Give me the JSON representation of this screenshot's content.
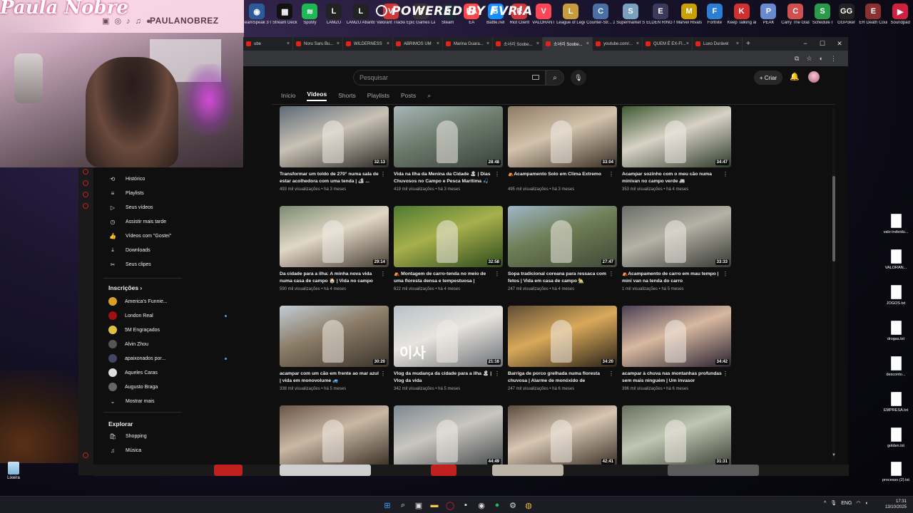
{
  "top_apps": [
    {
      "label": "TeamSpeak 3 Client",
      "color": "#2b5b9b",
      "glyph": "◉"
    },
    {
      "label": "Stream Deck",
      "color": "#111111",
      "glyph": "▦"
    },
    {
      "label": "Spotify",
      "color": "#1db954",
      "glyph": "≋"
    },
    {
      "label": "LAMZU",
      "color": "#222222",
      "glyph": "L"
    },
    {
      "label": "LAMZU Atlantis P...",
      "color": "#222222",
      "glyph": "L"
    },
    {
      "label": "Valorant Tracker",
      "color": "#d13639",
      "glyph": "V"
    },
    {
      "label": "Epic Games Launcher",
      "color": "#333333",
      "glyph": "E"
    },
    {
      "label": "Steam",
      "color": "#1b2838",
      "glyph": "S"
    },
    {
      "label": "EA",
      "color": "#ff4747",
      "glyph": "EA"
    },
    {
      "label": "Battle.net",
      "color": "#148eff",
      "glyph": "B"
    },
    {
      "label": "Riot Client",
      "color": "#d13639",
      "glyph": "R"
    },
    {
      "label": "VALORANT",
      "color": "#ff4655",
      "glyph": "V"
    },
    {
      "label": "League of Legends",
      "color": "#c89b3c",
      "glyph": "L"
    },
    {
      "label": "Counter-Str... 2",
      "color": "#4a6fa5",
      "glyph": "C"
    },
    {
      "label": "Supermarket Simulator",
      "color": "#7aa0c0",
      "glyph": "S"
    },
    {
      "label": "ELDEN RING NIGHTREIGN",
      "color": "#3a3a5a",
      "glyph": "E"
    },
    {
      "label": "Marvel Rivals",
      "color": "#c8a000",
      "glyph": "M"
    },
    {
      "label": "Fortnite",
      "color": "#2a7fd4",
      "glyph": "F"
    },
    {
      "label": "Keep Talking and Nobo...",
      "color": "#d03030",
      "glyph": "K"
    },
    {
      "label": "PEAK",
      "color": "#6a8ad0",
      "glyph": "P"
    },
    {
      "label": "Carry The Glass",
      "color": "#d05050",
      "glyph": "C"
    },
    {
      "label": "Schedule I",
      "color": "#2a9a4a",
      "glyph": "S"
    },
    {
      "label": "GGPoker",
      "color": "#222222",
      "glyph": "GG"
    },
    {
      "label": "ER Death Counter",
      "color": "#8a3030",
      "glyph": "E"
    },
    {
      "label": "Soundpad",
      "color": "#d02040",
      "glyph": "▶"
    }
  ],
  "powered_by": "POWERED BY FVRIA",
  "webcam": {
    "signature": "Paula Nobre",
    "handle": "PAULANOBREZ",
    "socials": "▣ ◎ ♪ ♫ ●"
  },
  "browser": {
    "tabs": [
      {
        "label": "ube",
        "active": false
      },
      {
        "label": "Noru Saru Bu...",
        "active": false
      },
      {
        "label": "WILDERNESS",
        "active": false
      },
      {
        "label": "ABRIMOS UM",
        "active": false
      },
      {
        "label": "Marina Guara...",
        "active": false
      },
      {
        "label": "소녀리 Soobe...",
        "active": false
      },
      {
        "label": "소녀리 Soobe...",
        "active": true
      },
      {
        "label": "youtube.com/...",
        "active": false
      },
      {
        "label": "QUEM É EX-FI...",
        "active": false
      },
      {
        "label": "Luxo Durável",
        "active": false
      }
    ]
  },
  "yt": {
    "search_placeholder": "Pesquisar",
    "create_label": "+ Criar",
    "nav": [
      "Início",
      "Vídeos",
      "Shorts",
      "Playlists",
      "Posts"
    ],
    "active_nav": 1
  },
  "videos": [
    {
      "title": "Transformar um toldo de 270° numa sala de estar acolhedora com uma tenda | 🏕 ...",
      "meta": "493 mil visualizações • há 3 meses",
      "duration": "32:13",
      "colors": [
        "#5d6a77",
        "#c9c2b5",
        "#2e2a26"
      ]
    },
    {
      "title": "Vida na Ilha da Menina da Cidade 🏝 | Dias Chuvosos no Campo e Pesca Marítima 🎣",
      "meta": "419 mil visualizações • há 3 meses",
      "duration": "28:48",
      "colors": [
        "#a7b6b7",
        "#6d7c6d",
        "#38403a"
      ]
    },
    {
      "title": "⛺Acampamento Solo em Clima Extremo",
      "meta": "495 mil visualizações • há 3 meses",
      "duration": "33:04",
      "colors": [
        "#8e7a62",
        "#d2c3ad",
        "#3a2f25"
      ]
    },
    {
      "title": "Acampar sozinho com o meu cão numa minivan no campo verde 🚐",
      "meta": "353 mil visualizações • há 4 meses",
      "duration": "34:47",
      "colors": [
        "#3e5a32",
        "#d8d2c6",
        "#2c3b2a"
      ]
    },
    {
      "title": "Da cidade para a ilha: A minha nova vida numa casa de campo 🏠 | Vida no campo",
      "meta": "590 mil visualizações • há 4 meses",
      "duration": "29:14",
      "colors": [
        "#7b8a72",
        "#e1d8c7",
        "#473e33"
      ]
    },
    {
      "title": "⛺ Montagem de carro-tenda no meio de uma floresta densa e tempestuosa | Carrei...",
      "meta": "622 mil visualizações • há 4 meses",
      "duration": "32:58",
      "colors": [
        "#4e7a30",
        "#a7b04c",
        "#2d4a1c"
      ]
    },
    {
      "title": "Sopa tradicional coreana para ressaca com fetos | Vida em casa de campo 🏡",
      "meta": "247 mil visualizações • há 4 meses",
      "duration": "27:47",
      "colors": [
        "#9fb6c8",
        "#6e7e55",
        "#404838"
      ]
    },
    {
      "title": "⛺Acampamento de carro em mau tempo | mini van na tenda do carro",
      "meta": "1 mil visualizações • há 5 meses",
      "duration": "33:33",
      "colors": [
        "#6a6f68",
        "#b5b2a6",
        "#353833"
      ]
    },
    {
      "title": "acampar com um cão em frente ao mar azul | vida em monovolume 🚙",
      "meta": "338 mil visualizações • há 5 meses",
      "duration": "30:20",
      "colors": [
        "#c2ccd4",
        "#8a7b66",
        "#3b342c"
      ]
    },
    {
      "title": "Vlog da mudança da cidade para a ilha 🏝 | Vlog da vida",
      "meta": "342 mil visualizações • há 5 meses",
      "duration": "21:16",
      "colors": [
        "#b8c1c8",
        "#e7e4de",
        "#6d7177"
      ],
      "overlay": "이사"
    },
    {
      "title": "Barriga de porco grelhada numa floresta chuvosa | Alarme de monóxido de carbono...",
      "meta": "247 mil visualizações • há 6 meses",
      "duration": "34:20",
      "colors": [
        "#5e4c35",
        "#d9a95a",
        "#2a2218"
      ]
    },
    {
      "title": "acampar à chuva nas montanhas profundas sem mais ninguém | Um invasor repentino?...",
      "meta": "396 mil visualizações • há 6 meses",
      "duration": "34:42",
      "colors": [
        "#4a3f55",
        "#d8b9a0",
        "#2a2230"
      ]
    },
    {
      "title": "",
      "meta": "",
      "duration": "",
      "colors": [
        "#6a5646",
        "#c8b8a4",
        "#3a2e24"
      ]
    },
    {
      "title": "",
      "meta": "",
      "duration": "44:49",
      "colors": [
        "#7d8890",
        "#c9c6bf",
        "#43484c"
      ]
    },
    {
      "title": "",
      "meta": "",
      "duration": "42:41",
      "colors": [
        "#5b4b3e",
        "#d6c6b2",
        "#3a2f26"
      ]
    },
    {
      "title": "",
      "meta": "",
      "duration": "31:31",
      "colors": [
        "#6a7060",
        "#bfc6b2",
        "#3b4033"
      ]
    }
  ],
  "sidebar": {
    "you_items": [
      {
        "icon": "⟲",
        "label": "Histórico",
        "icon_name": "history-icon"
      },
      {
        "icon": "≡",
        "label": "Playlists",
        "icon_name": "playlists-icon"
      },
      {
        "icon": "▷",
        "label": "Seus vídeos",
        "icon_name": "your-videos-icon"
      },
      {
        "icon": "◷",
        "label": "Assistir mais tarde",
        "icon_name": "watch-later-icon"
      },
      {
        "icon": "👍",
        "label": "Vídeos com \"Gostei\"",
        "icon_name": "liked-videos-icon"
      },
      {
        "icon": "⤓",
        "label": "Downloads",
        "icon_name": "downloads-icon"
      },
      {
        "icon": "✂",
        "label": "Seus clipes",
        "icon_name": "clips-icon"
      }
    ],
    "subs_title": "Inscrições",
    "subs": [
      {
        "label": "America's Funnie...",
        "color": "#d8a020",
        "dot": false
      },
      {
        "label": "London Real",
        "color": "#a01010",
        "dot": true
      },
      {
        "label": "5M Engraçados",
        "color": "#e0c040",
        "dot": false
      },
      {
        "label": "Alvin Zhou",
        "color": "#555555",
        "dot": false
      },
      {
        "label": "apaixonados por...",
        "color": "#444466",
        "dot": true
      },
      {
        "label": "Aqueles Caras",
        "color": "#dddddd",
        "dot": false
      },
      {
        "label": "Augusto Braga",
        "color": "#666666",
        "dot": false
      }
    ],
    "show_more": "Mostrar mais",
    "explore_title": "Explorar",
    "explore_items": [
      {
        "icon": "🛍",
        "label": "Shopping",
        "icon_name": "shopping-icon"
      },
      {
        "icon": "♫",
        "label": "Música",
        "icon_name": "music-icon"
      }
    ]
  },
  "desktop_files": [
    "valo individu...",
    "VALORAN...",
    "JOGOS.txt",
    "drogas.txt",
    "desconto...",
    "EMPRESA.txt",
    "golden.txt",
    "processo (2).txt"
  ],
  "trash_label": "Lixeira",
  "taskbar": {
    "lang": "ENG",
    "time": "17:31",
    "date": "13/10/2025"
  }
}
